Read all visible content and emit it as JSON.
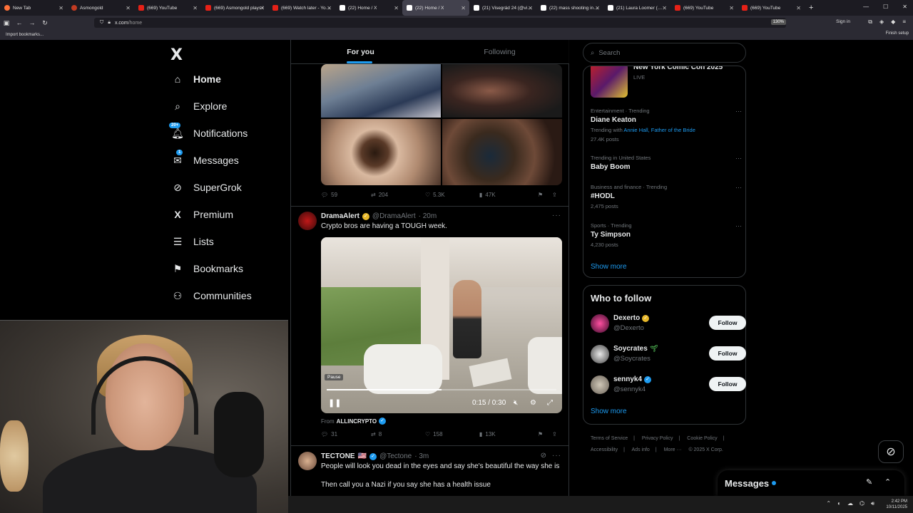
{
  "browser": {
    "tabs": [
      {
        "title": "New Tab",
        "icon": "firefox-icon",
        "active": false
      },
      {
        "title": "Asmongold",
        "icon": "asmongold-icon",
        "active": false
      },
      {
        "title": "(669) YouTube",
        "icon": "youtube-icon",
        "active": false
      },
      {
        "title": "(669) Asmongold plays I",
        "icon": "youtube-icon",
        "active": false
      },
      {
        "title": "(669) Watch later - YouT",
        "icon": "youtube-icon",
        "active": false
      },
      {
        "title": "(22) Home / X",
        "icon": "x-icon",
        "active": false
      },
      {
        "title": "(22) Home / X",
        "icon": "x-icon",
        "active": true
      },
      {
        "title": "(21) Visegrád 24 (@vise",
        "icon": "x-icon",
        "active": false
      },
      {
        "title": "(22) mass shooting in La",
        "icon": "x-icon",
        "active": false
      },
      {
        "title": "(21) Laura Loomer (@Lau",
        "icon": "x-icon",
        "active": false
      },
      {
        "title": "(669) YouTube",
        "icon": "youtube-icon",
        "active": false
      },
      {
        "title": "(669) YouTube",
        "icon": "youtube-icon",
        "active": false
      }
    ],
    "url_host": "x.com",
    "url_path": "/home",
    "zoom": "130%",
    "sign_in": "Sign in",
    "bookmark_import": "Import bookmarks...",
    "finish_setup": "Finish setup"
  },
  "sidebar": {
    "logo": "X",
    "items": [
      {
        "label": "Home",
        "icon": "home-icon"
      },
      {
        "label": "Explore",
        "icon": "search-icon"
      },
      {
        "label": "Notifications",
        "icon": "bell-icon",
        "badge": "20+"
      },
      {
        "label": "Messages",
        "icon": "mail-icon",
        "badge": "1"
      },
      {
        "label": "SuperGrok",
        "icon": "grok-icon"
      },
      {
        "label": "Premium",
        "icon": "x-icon"
      },
      {
        "label": "Lists",
        "icon": "list-icon"
      },
      {
        "label": "Bookmarks",
        "icon": "bookmark-icon"
      },
      {
        "label": "Communities",
        "icon": "communities-icon"
      }
    ]
  },
  "feed": {
    "tabs": [
      "For you",
      "Following"
    ],
    "post1_stats": {
      "replies": "59",
      "reposts": "204",
      "likes": "5.3K",
      "views": "47K"
    },
    "post2": {
      "name": "DramaAlert",
      "handle": "@DramaAlert",
      "time": "· 20m",
      "text": "Crypto bros are having a TOUGH week.",
      "video_time": "0:15 / 0:30",
      "video_progress": 0.5,
      "pause_tooltip": "Pause",
      "from_label": "From",
      "from_name": "ALLINCRYPTO",
      "stats": {
        "replies": "31",
        "reposts": "8",
        "likes": "158",
        "views": "13K"
      }
    },
    "post3": {
      "name": "TECTONE",
      "flag": "🇺🇸",
      "handle": "@Tectone",
      "time": "· 3m",
      "text1": "People will look you dead in the eyes and say she's beautiful the way she is",
      "text2": "Then call you a Nazi if you say she has a health issue"
    }
  },
  "right": {
    "search_placeholder": "Search",
    "event": {
      "title": "New York Comic Con 2025",
      "status": "LIVE"
    },
    "trends": [
      {
        "category": "Entertainment · Trending",
        "name": "Diane Keaton",
        "meta_prefix": "Trending with",
        "meta_links": "Annie Hall, Father of the Bride",
        "posts": "27.4K posts"
      },
      {
        "category": "Trending in United States",
        "name": "Baby Boom",
        "posts": ""
      },
      {
        "category": "Business and finance · Trending",
        "name": "#HODL",
        "posts": "2,475 posts"
      },
      {
        "category": "Sports · Trending",
        "name": "Ty Simpson",
        "posts": "4,230 posts"
      }
    ],
    "show_more": "Show more",
    "who_title": "Who to follow",
    "who": [
      {
        "name": "Dexerto",
        "handle": "@Dexerto",
        "badge": "gold",
        "button": "Follow"
      },
      {
        "name": "Soycrates",
        "handle": "@Soycrates",
        "badge": "sprout",
        "button": "Follow"
      },
      {
        "name": "sennyk4",
        "handle": "@sennyk4",
        "badge": "blue",
        "button": "Follow"
      }
    ],
    "who_show_more": "Show more",
    "footer": [
      "Terms of Service",
      "|",
      "Privacy Policy",
      "|",
      "Cookie Policy",
      "|",
      "Accessibility",
      "|",
      "Ads info",
      "|",
      "More ···",
      "© 2025 X Corp."
    ]
  },
  "messages_drawer": {
    "title": "Messages"
  },
  "taskbar": {
    "time": "2:42 PM",
    "date": "10/11/2025"
  },
  "colors": {
    "accent": "#1d9bf0",
    "bg": "#000000",
    "text": "#e7e9ea",
    "muted": "#71767b",
    "border": "#2f3336"
  }
}
